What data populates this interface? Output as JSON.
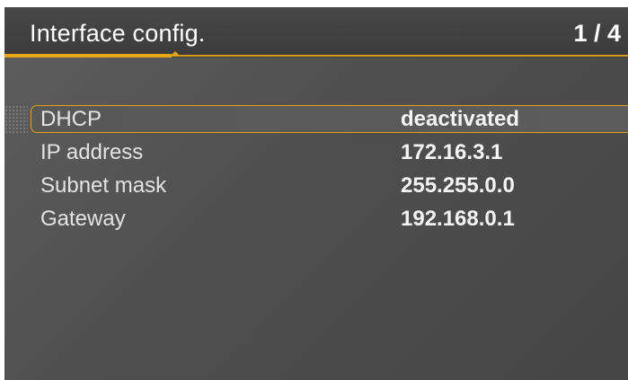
{
  "header": {
    "title": "Interface config.",
    "page_indicator": "1 / 4"
  },
  "colors": {
    "accent": "#e5a716",
    "background": "#555555",
    "header_background": "#3f3f3f",
    "text": "#ffffff"
  },
  "settings": [
    {
      "label": "DHCP",
      "value": "deactivated",
      "selected": true
    },
    {
      "label": "IP address",
      "value": "172.16.3.1",
      "selected": false
    },
    {
      "label": "Subnet mask",
      "value": "255.255.0.0",
      "selected": false
    },
    {
      "label": "Gateway",
      "value": "192.168.0.1",
      "selected": false
    }
  ],
  "icons": {
    "grip": "drag-grip-icon"
  }
}
